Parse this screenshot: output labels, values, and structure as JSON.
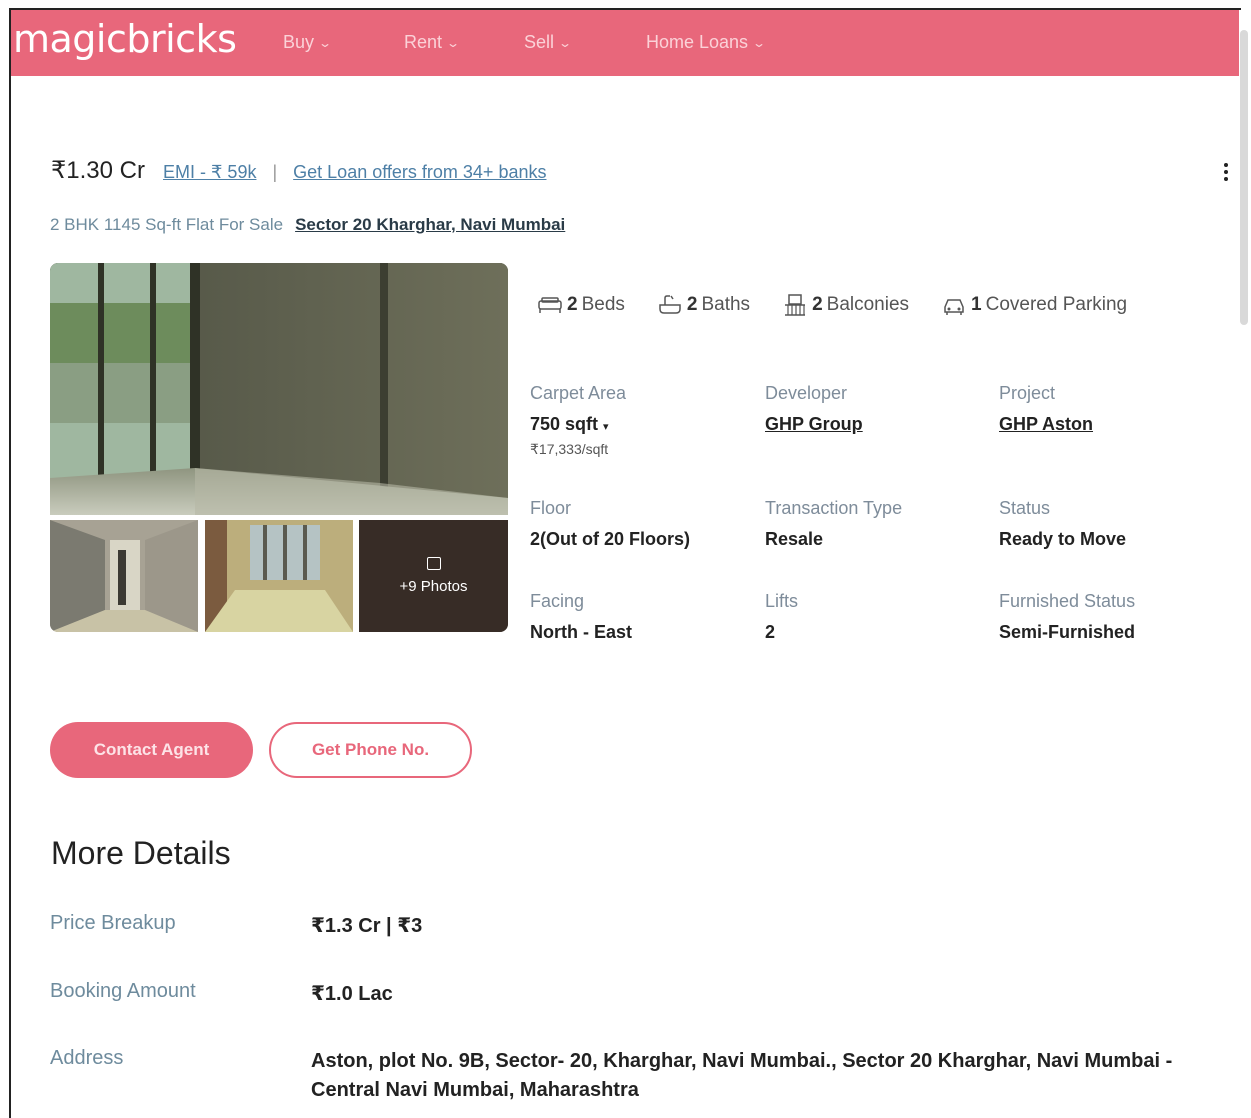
{
  "nav": {
    "logo": "magicbricks",
    "items": [
      {
        "label": "Buy"
      },
      {
        "label": "Rent"
      },
      {
        "label": "Sell"
      },
      {
        "label": "Home Loans"
      }
    ]
  },
  "listing": {
    "price": "₹1.30 Cr",
    "emi": "EMI - ₹ 59k",
    "separator": "|",
    "loan_offer": "Get Loan offers from 34+ banks",
    "subtitle": "2 BHK 1145 Sq-ft Flat For Sale",
    "location": "Sector 20 Kharghar, Navi Mumbai",
    "more_photos": "+9 Photos"
  },
  "amenities": [
    {
      "count": "2",
      "label": "Beds",
      "icon": "bed-icon"
    },
    {
      "count": "2",
      "label": "Baths",
      "icon": "bathtub-icon"
    },
    {
      "count": "2",
      "label": "Balconies",
      "icon": "balcony-icon"
    },
    {
      "count": "1",
      "label": "Covered Parking",
      "icon": "car-icon"
    }
  ],
  "specs": {
    "carpet_area": {
      "label": "Carpet Area",
      "value": "750 sqft",
      "sub": "₹17,333/sqft"
    },
    "developer": {
      "label": "Developer",
      "value": "GHP Group"
    },
    "project": {
      "label": "Project",
      "value": "GHP Aston"
    },
    "floor": {
      "label": "Floor",
      "value": "2(Out of 20 Floors)"
    },
    "transaction": {
      "label": "Transaction Type",
      "value": "Resale"
    },
    "status": {
      "label": "Status",
      "value": "Ready to Move"
    },
    "facing": {
      "label": "Facing",
      "value": "North - East"
    },
    "lifts": {
      "label": "Lifts",
      "value": "2"
    },
    "furnished": {
      "label": "Furnished Status",
      "value": "Semi-Furnished"
    }
  },
  "actions": {
    "contact": "Contact Agent",
    "phone": "Get Phone No."
  },
  "more_details": {
    "title": "More Details",
    "rows": [
      {
        "label": "Price Breakup",
        "value": "₹1.3 Cr | ₹3"
      },
      {
        "label": "Booking Amount",
        "value": "₹1.0 Lac"
      },
      {
        "label": "Address",
        "value": "Aston, plot No. 9B, Sector- 20, Kharghar, Navi Mumbai., Sector 20 Kharghar, Navi Mumbai - Central Navi Mumbai, Maharashtra"
      }
    ]
  },
  "colors": {
    "brand": "#e8677b",
    "link": "#4d7fa6"
  }
}
